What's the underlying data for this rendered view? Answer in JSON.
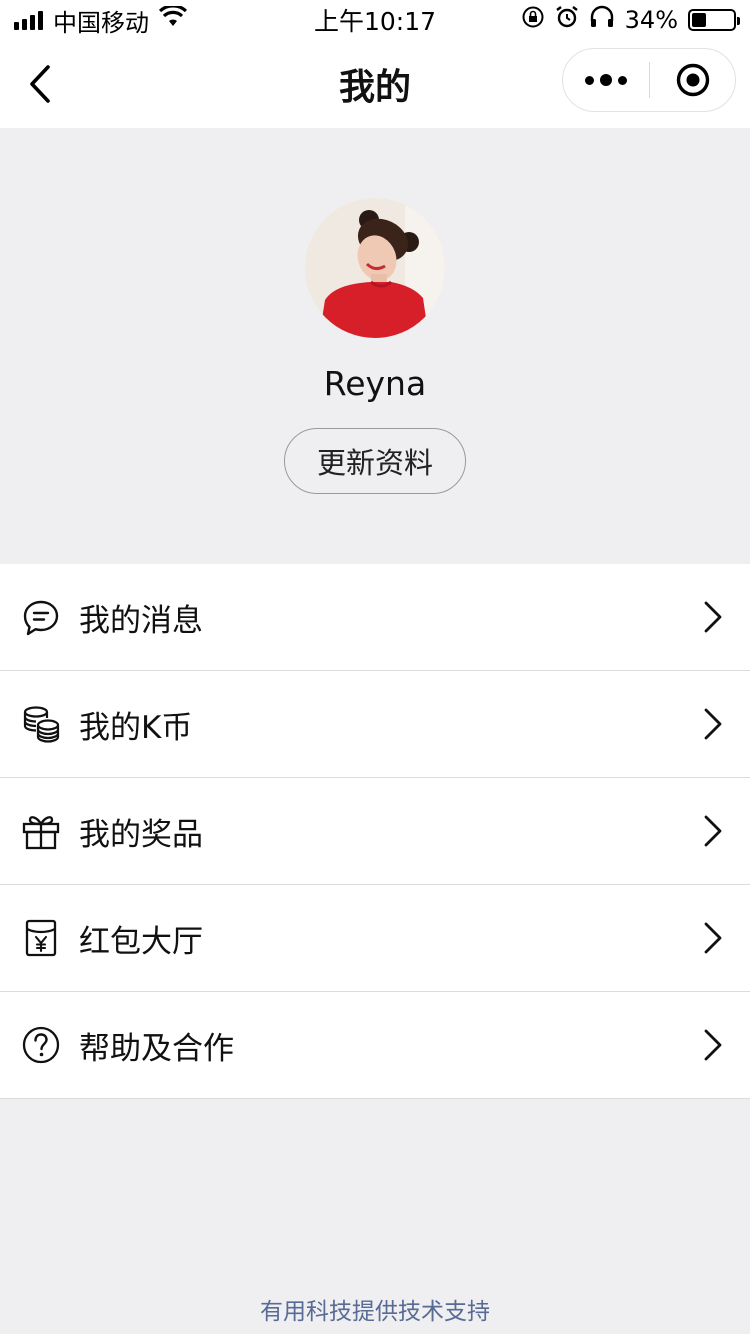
{
  "status_bar": {
    "carrier": "中国移动",
    "time": "上午10:17",
    "battery_percent": "34%",
    "battery_level": 0.34
  },
  "nav": {
    "title": "我的"
  },
  "profile": {
    "username": "Reyna",
    "update_button": "更新资料"
  },
  "menu": {
    "items": [
      {
        "label": "我的消息",
        "icon": "chat-bubble-icon"
      },
      {
        "label": "我的K币",
        "icon": "coins-icon"
      },
      {
        "label": "我的奖品",
        "icon": "gift-icon"
      },
      {
        "label": "红包大厅",
        "icon": "red-envelope-icon"
      },
      {
        "label": "帮助及合作",
        "icon": "help-icon"
      }
    ]
  },
  "footer": {
    "text": "有用科技提供技术支持"
  },
  "colors": {
    "background": "#efeef1",
    "footer_link": "#576b95"
  }
}
